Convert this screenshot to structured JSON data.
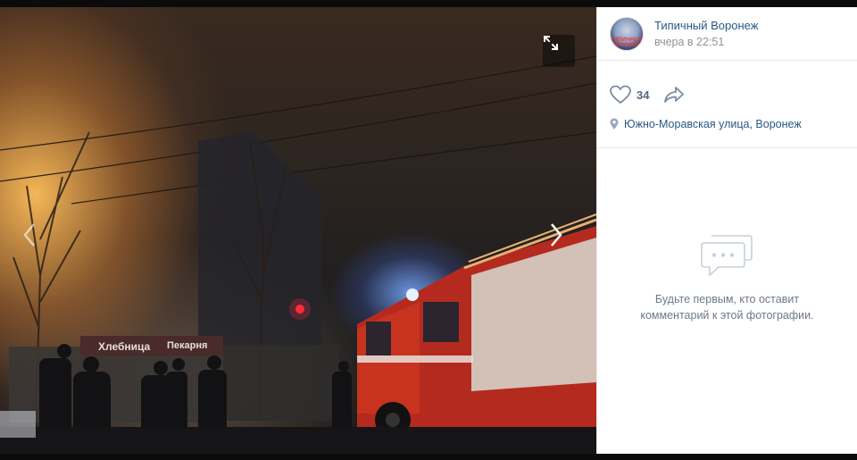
{
  "post": {
    "author_name": "Типичный Воронеж",
    "avatar_text": "ТИПИЧНЫЙ ВОРОНЕЖ",
    "time": "вчера в 22:51",
    "likes": "34",
    "location": "Южно-Моравская улица, Воронеж"
  },
  "comments": {
    "empty_line1": "Будьте первым, кто оставит",
    "empty_line2": "комментарий к этой фотографии."
  },
  "photo": {
    "sign_bakery": "Хлебница",
    "sign_shop": "Пекарня"
  },
  "icons": {
    "expand": "expand-icon",
    "prev": "chevron-left-icon",
    "next": "chevron-right-icon",
    "like": "heart-icon",
    "share": "share-arrow-icon",
    "location": "location-pin-icon",
    "comments": "chat-bubble-icon"
  },
  "colors": {
    "link": "#2a5885",
    "muted": "#939393",
    "sidebar_bg": "#ffffff"
  }
}
